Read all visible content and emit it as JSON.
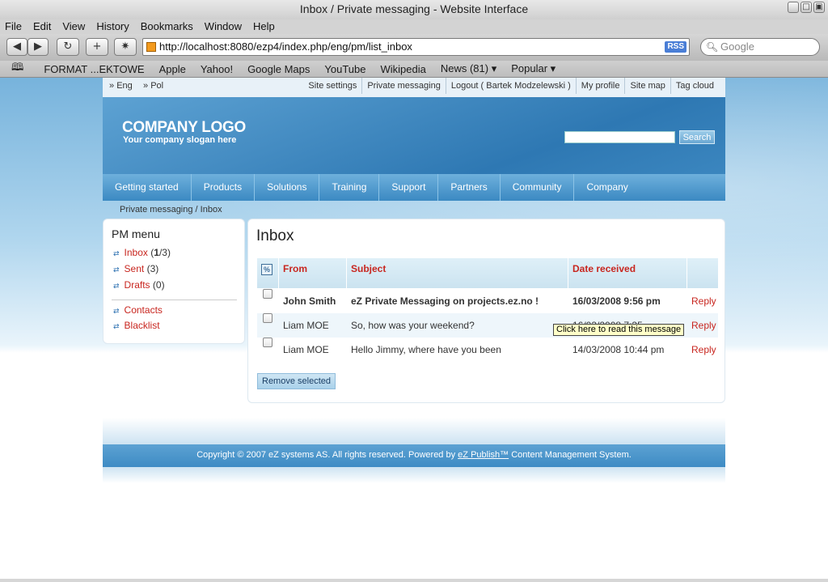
{
  "window": {
    "title": "Inbox / Private messaging - Website Interface",
    "btns": [
      " ",
      "□",
      "▣"
    ]
  },
  "menubar": {
    "items": [
      "File",
      "Edit",
      "View",
      "History",
      "Bookmarks",
      "Window",
      "Help"
    ]
  },
  "toolbar": {
    "url": "http://localhost:8080/ezp4/index.php/eng/pm/list_inbox",
    "rss": "RSS",
    "search_placeholder": "Google",
    "back": "◀",
    "fwd": "▶",
    "reload": "↻",
    "add": "+",
    "bug": "✷"
  },
  "bookmarks": {
    "items": [
      "FORMAT ...EKTOWE",
      "Apple",
      "Yahoo!",
      "Google Maps",
      "YouTube",
      "Wikipedia",
      "News (81) ▾",
      "Popular ▾"
    ]
  },
  "site": {
    "langs": [
      "Eng",
      "Pol"
    ],
    "toplinks": [
      "Site settings",
      "Private messaging",
      "Logout ( Bartek Modzelewski )",
      "My profile",
      "Site map",
      "Tag cloud"
    ],
    "logo": "COMPANY LOGO",
    "slogan": "Your company slogan here",
    "search_button": "Search",
    "nav": [
      "Getting started",
      "Products",
      "Solutions",
      "Training",
      "Support",
      "Partners",
      "Community",
      "Company"
    ],
    "breadcrumb": "Private messaging / Inbox"
  },
  "pm": {
    "title": "PM menu",
    "inbox": "Inbox",
    "inbox_count_bold": "1",
    "inbox_total": "/3)",
    "sent": "Sent",
    "sent_count": "(3)",
    "drafts": "Drafts",
    "drafts_count": "(0)",
    "contacts": "Contacts",
    "blacklist": "Blacklist"
  },
  "inbox": {
    "title": "Inbox",
    "headers": {
      "from": "From",
      "subject": "Subject",
      "date": "Date received"
    },
    "rows": [
      {
        "from": "John Smith",
        "subject": "eZ Private Messaging on projects.ez.no !",
        "date": "16/03/2008 9:56 pm",
        "reply": "Reply"
      },
      {
        "from": "Liam MOE",
        "subject": "So, how was your weekend?",
        "date": "16/03/2008 7:35",
        "reply": "Reply"
      },
      {
        "from": "Liam MOE",
        "subject": "Hello Jimmy, where have you been",
        "date": "14/03/2008 10:44 pm",
        "reply": "Reply"
      }
    ],
    "tooltip": "Click here to read this message",
    "remove_button": "Remove selected"
  },
  "footer": {
    "text1": "Copyright © 2007 eZ systems AS. All rights reserved. Powered by ",
    "link": "eZ Publish™",
    "text2": " Content Management System."
  }
}
